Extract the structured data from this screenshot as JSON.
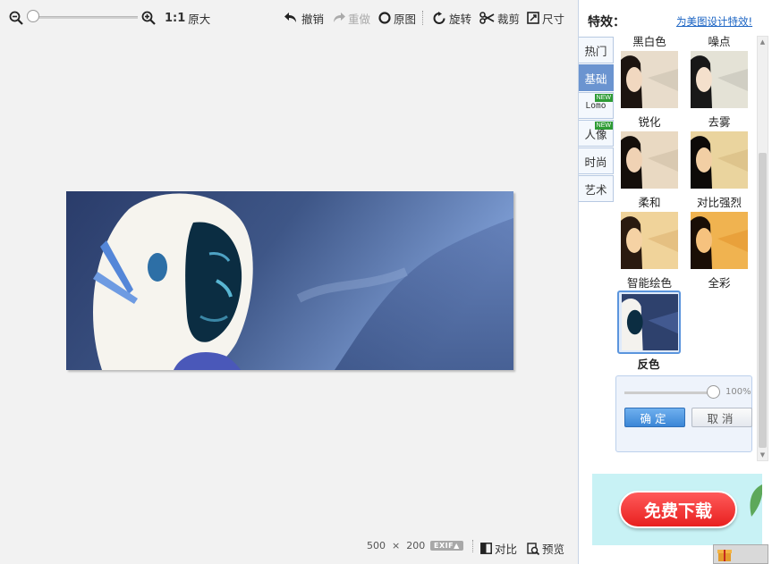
{
  "toolbar": {
    "zoom": {
      "level_fraction": 0.0
    },
    "ratio_label": "1:1",
    "original_size_label": "原大",
    "undo_label": "撤销",
    "redo_label": "重做",
    "original_label": "原图",
    "rotate_label": "旋转",
    "crop_label": "裁剪",
    "resize_label": "尺寸"
  },
  "status": {
    "width": "500",
    "times": "×",
    "height": "200",
    "exif_label": "EXIF▲",
    "compare_label": "对比",
    "preview_label": "预览"
  },
  "panel": {
    "title": "特效：",
    "link": "为美图设计特效!",
    "categories": [
      {
        "label": "热门",
        "active": false,
        "new": false
      },
      {
        "label": "基础",
        "active": true,
        "new": false
      },
      {
        "label": "Lomo",
        "active": false,
        "new": true
      },
      {
        "label": "人像",
        "active": false,
        "new": true
      },
      {
        "label": "时尚",
        "active": false,
        "new": false
      },
      {
        "label": "艺术",
        "active": false,
        "new": false
      }
    ],
    "new_badge": "NEW",
    "effects": [
      {
        "label": "黑白色"
      },
      {
        "label": "噪点"
      },
      {
        "label": "锐化"
      },
      {
        "label": "去雾"
      },
      {
        "label": "柔和"
      },
      {
        "label": "对比强烈"
      },
      {
        "label": "智能绘色"
      },
      {
        "label": "全彩"
      }
    ],
    "selected_effect": "反色",
    "intensity_percent": 100,
    "intensity_label": "100%",
    "ok_label": "确定",
    "cancel_label": "取消"
  },
  "ad": {
    "label": "免费下载"
  },
  "colors": {
    "accent": "#6b94d0",
    "link": "#1a63c3",
    "ad_red": "#e8201f",
    "new_green": "#2e9b35"
  }
}
